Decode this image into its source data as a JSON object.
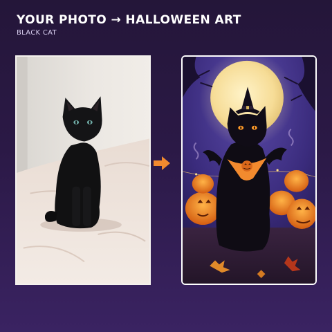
{
  "header": {
    "title": "YOUR PHOTO → HALLOWEEN ART",
    "subtitle": "BLACK CAT"
  },
  "images": {
    "original": {
      "description_icon": "photo-icon"
    },
    "result": {
      "description_icon": "halloween-art-icon"
    }
  },
  "colors": {
    "background": "#2b1946",
    "arrow": "#f28a2e",
    "panel_border": "#ffffff"
  }
}
